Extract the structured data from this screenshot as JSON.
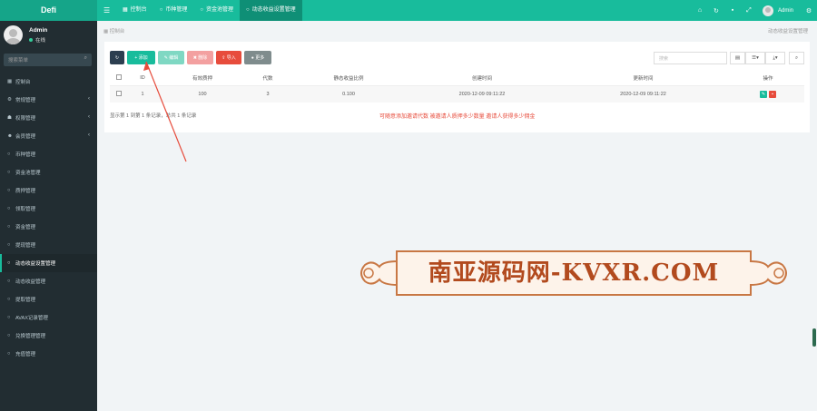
{
  "brand": "Defi",
  "topnav": {
    "tabs": [
      {
        "icon": "dashboard-icon",
        "label": "控制台"
      },
      {
        "icon": "circle-icon",
        "label": "币种管理"
      },
      {
        "icon": "circle-icon",
        "label": "资金池管理"
      },
      {
        "icon": "circle-icon",
        "label": "动态收益设置管理"
      }
    ],
    "username": "Admin"
  },
  "sidebar": {
    "user": {
      "name": "Admin",
      "status": "在线"
    },
    "search_placeholder": "搜索菜单",
    "items": [
      {
        "label": "控制台"
      },
      {
        "label": "常规管理"
      },
      {
        "label": "权限管理"
      },
      {
        "label": "会员管理"
      },
      {
        "label": "币种管理"
      },
      {
        "label": "资金池管理"
      },
      {
        "label": "质押管理"
      },
      {
        "label": "领取管理"
      },
      {
        "label": "资金管理"
      },
      {
        "label": "提现管理"
      },
      {
        "label": "动态收益设置管理"
      },
      {
        "label": "动态收益管理"
      },
      {
        "label": "提取管理"
      },
      {
        "label": "AVAX记录管理"
      },
      {
        "label": "兑换管理管理"
      },
      {
        "label": "充值管理"
      }
    ]
  },
  "breadcrumb": "控制台",
  "breadcrumb_right": "动态收益设置管理",
  "toolbar": {
    "add": "添加",
    "edit": "编辑",
    "delete": "删除",
    "import": "导入",
    "more": "更多",
    "search_placeholder": "搜索"
  },
  "table": {
    "headers": [
      "ID",
      "有效质押",
      "代数",
      "静态收益比例",
      "创建时间",
      "更新时间",
      "操作"
    ],
    "rows": [
      {
        "id": "1",
        "valid": "100",
        "gen": "3",
        "ratio": "0.100",
        "created": "2020-12-09 09:11:22",
        "updated": "2020-12-09 09:11:22"
      }
    ]
  },
  "page_info": "显示第 1 到第 1 条记录，总共 1 条记录",
  "tip": "可随意添加邀请代数  被邀请人质押多少数量  邀请人获得多少佣金",
  "watermark": "南亚源码网-KVXR.COM",
  "colors": {
    "primary": "#18bc9c",
    "sidebar": "#222d32",
    "danger": "#e74c3c"
  }
}
